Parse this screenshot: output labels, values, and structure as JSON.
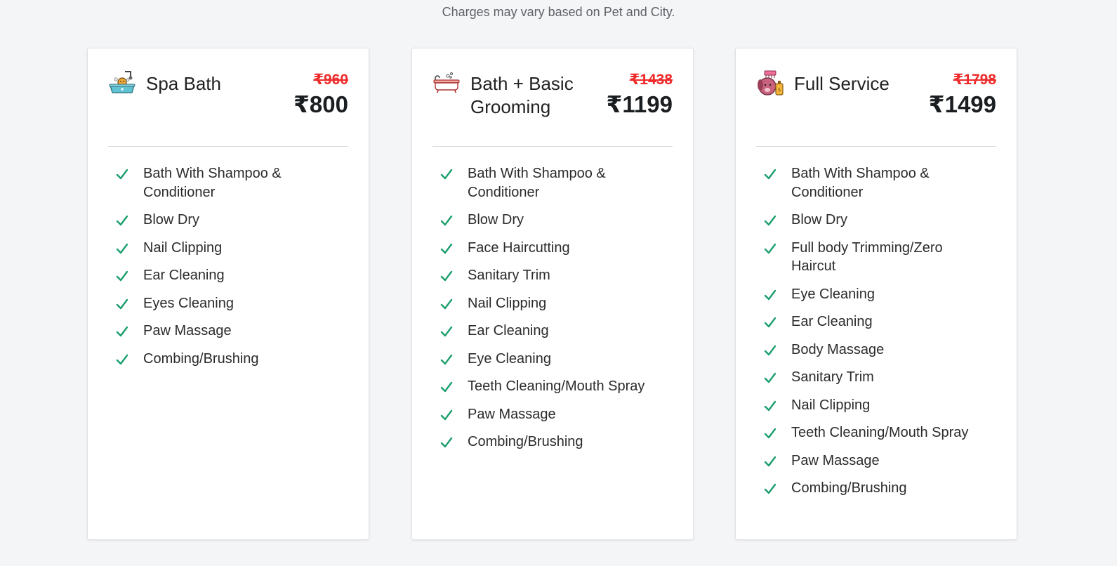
{
  "note": "Charges may vary based on Pet and City.",
  "colors": {
    "check": "#1a9e6b",
    "old_price": "#ee2b2b"
  },
  "cards": [
    {
      "icon": "dog-bath-tub-icon",
      "title": "Spa Bath",
      "old_price": "₹960",
      "price": "₹800",
      "features": [
        "Bath With Shampoo & Conditioner",
        "Blow Dry",
        "Nail Clipping",
        "Ear Cleaning",
        "Eyes Cleaning",
        "Paw Massage",
        "Combing/Brushing"
      ]
    },
    {
      "icon": "bathtub-icon",
      "title": "Bath + Basic Grooming",
      "old_price": "₹1438",
      "price": "₹1199",
      "features": [
        "Bath With Shampoo & Conditioner",
        "Blow Dry",
        "Face Haircutting",
        "Sanitary Trim",
        "Nail Clipping",
        "Ear Cleaning",
        "Eye Cleaning",
        "Teeth Cleaning/Mouth Spray",
        "Paw Massage",
        "Combing/Brushing"
      ]
    },
    {
      "icon": "dog-grooming-icon",
      "title": "Full Service",
      "old_price": "₹1798",
      "price": "₹1499",
      "features": [
        "Bath With Shampoo & Conditioner",
        "Blow Dry",
        "Full body Trimming/Zero Haircut",
        "Eye Cleaning",
        "Ear Cleaning",
        "Body Massage",
        "Sanitary Trim",
        "Nail Clipping",
        "Teeth Cleaning/Mouth Spray",
        "Paw Massage",
        "Combing/Brushing"
      ]
    }
  ]
}
